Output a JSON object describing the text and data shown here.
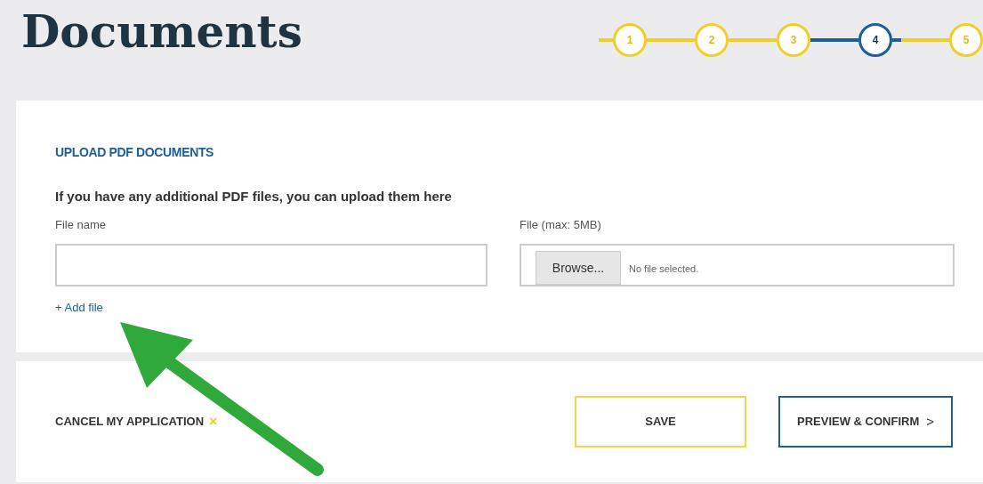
{
  "title": "Documents",
  "steps": [
    {
      "label": "1",
      "selected": false
    },
    {
      "label": "2",
      "selected": false
    },
    {
      "label": "3",
      "selected": false
    },
    {
      "label": "4",
      "selected": true
    },
    {
      "label": "5",
      "selected": false
    }
  ],
  "upload": {
    "heading": "UPLOAD PDF DOCUMENTS",
    "intro": "If you have any additional PDF files, you can upload them here",
    "file_name_label": "File name",
    "file_label": "File (max: 5MB)",
    "browse": "Browse...",
    "no_file": "No file selected.",
    "add_file": "+ Add file"
  },
  "footer": {
    "cancel": "CANCEL MY APPLICATION",
    "cancel_icon": "×",
    "save": "SAVE",
    "preview": "PREVIEW & CONFIRM",
    "preview_icon": ">"
  }
}
